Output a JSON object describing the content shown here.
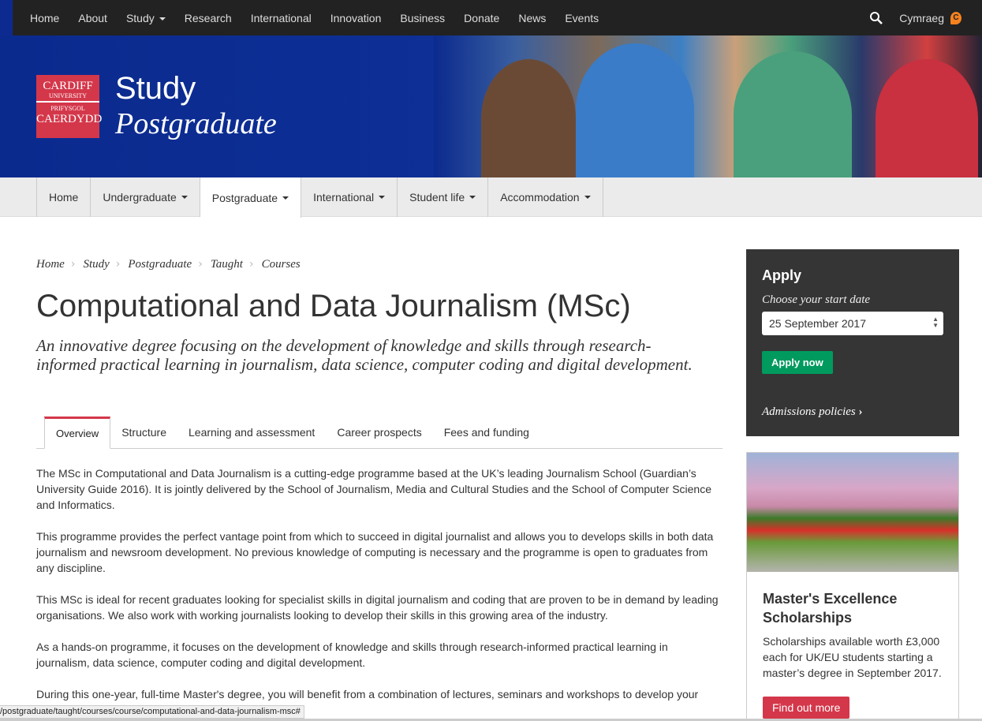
{
  "topnav": {
    "items": [
      {
        "label": "Home"
      },
      {
        "label": "About"
      },
      {
        "label": "Study",
        "dropdown": true
      },
      {
        "label": "Research"
      },
      {
        "label": "International"
      },
      {
        "label": "Innovation"
      },
      {
        "label": "Business"
      },
      {
        "label": "Donate"
      },
      {
        "label": "News"
      },
      {
        "label": "Events"
      }
    ],
    "language": "Cymraeg",
    "language_badge": "C"
  },
  "banner": {
    "logo": {
      "line1": "CARDIFF",
      "line2": "UNIVERSITY",
      "line3": "PRIFYSGOL",
      "line4": "CAERDYDD"
    },
    "title": "Study",
    "subtitle": "Postgraduate"
  },
  "subnav": {
    "items": [
      {
        "label": "Home"
      },
      {
        "label": "Undergraduate"
      },
      {
        "label": "Postgraduate"
      },
      {
        "label": "International"
      },
      {
        "label": "Student life"
      },
      {
        "label": "Accommodation"
      }
    ],
    "active": "Postgraduate"
  },
  "breadcrumb": [
    "Home",
    "Study",
    "Postgraduate",
    "Taught",
    "Courses"
  ],
  "page": {
    "title": "Computational and Data Journalism (MSc)",
    "intro": "An innovative degree focusing on the development of knowledge and skills through research-informed practical learning in journalism, data science, computer coding and digital development."
  },
  "tabs": [
    {
      "label": "Overview"
    },
    {
      "label": "Structure"
    },
    {
      "label": "Learning and assessment"
    },
    {
      "label": "Career prospects"
    },
    {
      "label": "Fees and funding"
    }
  ],
  "paragraphs": [
    "The MSc in Computational and Data Journalism is a cutting-edge programme based at the UK’s leading Journalism School (Guardian’s University Guide 2016). It is jointly delivered by the School of Journalism, Media and Cultural Studies and the School of Computer Science and Informatics.",
    "This programme provides the perfect vantage point from which to succeed in digital journalist and allows you to develops skills in both data journalism and newsroom development. No previous knowledge of computing is necessary and the programme is open to graduates from any discipline.",
    "This MSc is ideal for recent graduates looking for specialist skills in digital journalism and coding that are proven to be in demand by leading organisations. We also work with working journalists looking to develop their skills in this growing area of the industry.",
    "As a hands-on programme, it focuses on the development of knowledge and skills through research-informed practical learning in journalism, data science, computer coding and digital development.",
    "During this one-year, full-time Master's degree, you will benefit from a combination of lectures, seminars and workshops to develop your"
  ],
  "apply": {
    "title": "Apply",
    "label": "Choose your start date",
    "selected": "25 September 2017",
    "button": "Apply now",
    "policies": "Admissions policies"
  },
  "scholarship": {
    "title": "Master's Excellence Scholarships",
    "text": "Scholarships available worth £3,000 each for UK/EU students starting a master’s degree in September 2017.",
    "button": "Find out more"
  },
  "statusbar": "/postgraduate/taught/courses/course/computational-and-data-journalism-msc#",
  "colors": {
    "brand_red": "#d4374a",
    "apply_green": "#009a5e",
    "banner_blue": "#0c2a8f",
    "topbar": "#222222"
  }
}
